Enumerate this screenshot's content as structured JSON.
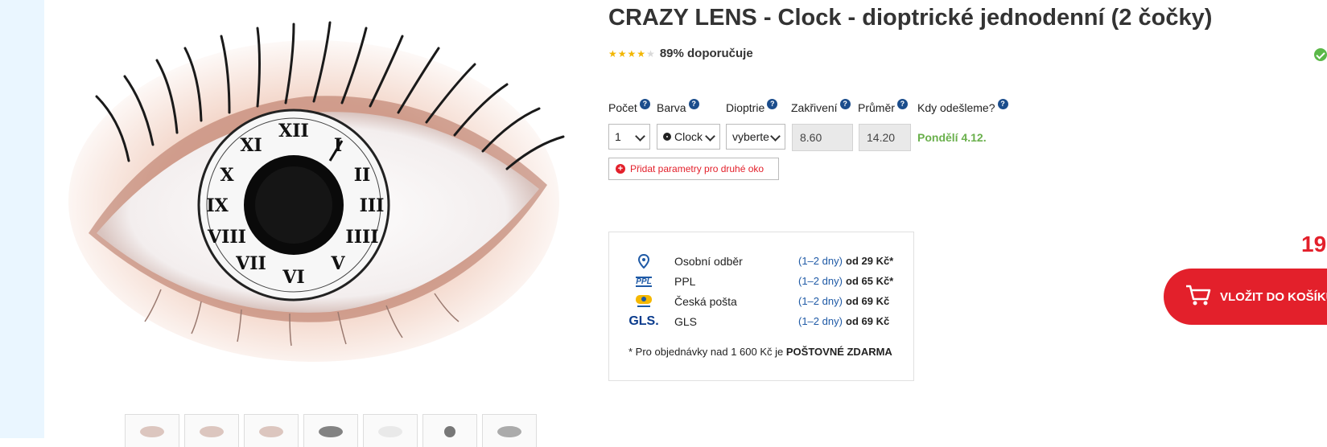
{
  "product": {
    "title": "CRAZY LENS - Clock - dioptrické jednodenní (2 čočky)",
    "rating_text": "89% doporučuje",
    "rating_stars": 4.5,
    "image_alt": "Clock contact lens on eye"
  },
  "params": {
    "labels": [
      "Počet",
      "Barva",
      "Dioptrie",
      "Zakřivení",
      "Průměr",
      "Kdy odešleme?"
    ],
    "help_symbol": "?",
    "count_value": "1",
    "color_value": "Clock",
    "diopter_value": "vyberte",
    "curvature_value": "8.60",
    "diameter_value": "14.20",
    "ship_date": "Pondělí 4.12.",
    "second_eye_label": "Přidat parametry pro druhé oko"
  },
  "delivery": {
    "rows": [
      {
        "name": "Osobní odběr",
        "days": "(1–2 dny)",
        "price": "od 29 Kč*",
        "icon": "location-pin-icon"
      },
      {
        "name": "PPL",
        "days": "(1–2 dny)",
        "price": "od 65 Kč*",
        "icon": "ppl-logo-icon"
      },
      {
        "name": "Česká pošta",
        "days": "(1–2 dny)",
        "price": "od 69 Kč",
        "icon": "ceska-posta-logo-icon"
      },
      {
        "name": "GLS",
        "days": "(1–2 dny)",
        "price": "od 69 Kč",
        "icon": "gls-logo-icon"
      }
    ],
    "note_prefix": "* Pro objednávky nad 1 600 Kč je",
    "note_bold": "POŠTOVNÉ ZDARMA",
    "ppl_logo": "PPL",
    "gls_logo": "GLS."
  },
  "purchase": {
    "price_partial": "19",
    "cart_label": "VLOŽIT DO KOŠÍKU"
  },
  "colors": {
    "accent_red": "#e3202b",
    "ship_green": "#6ab04c",
    "help_blue": "#1b4d8c"
  }
}
